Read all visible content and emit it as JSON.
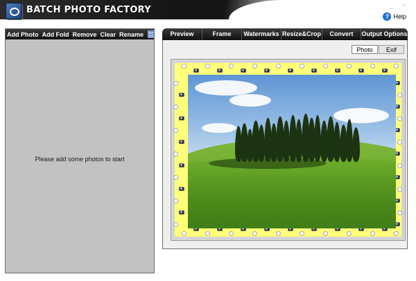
{
  "app": {
    "title": "BATCH PHOTO FACTORY",
    "help_label": "Help",
    "window_controls": [
      "minimize",
      "close"
    ]
  },
  "left_toolbar": {
    "buttons": [
      "Add Photo",
      "Add Fold",
      "Remove",
      "Clear",
      "Rename"
    ],
    "view_toggle_icon": "grid-view-icon"
  },
  "left_panel": {
    "empty_message": "Please add some photos to start"
  },
  "main_tabs": [
    "Preview",
    "Frame",
    "Watermarks",
    "Resize&Crop",
    "Convert",
    "Output Options"
  ],
  "preview": {
    "subtabs": [
      "Photo",
      "Exif"
    ],
    "active_subtab": "Photo",
    "frame_color": "#ffff7a",
    "frame_icons": [
      "camera-icon",
      "pin-icon"
    ]
  },
  "colors": {
    "toolbar_bg": "#1a1a1a",
    "panel_bg": "#c2c2c2",
    "frame_yellow": "#ffff7a"
  }
}
